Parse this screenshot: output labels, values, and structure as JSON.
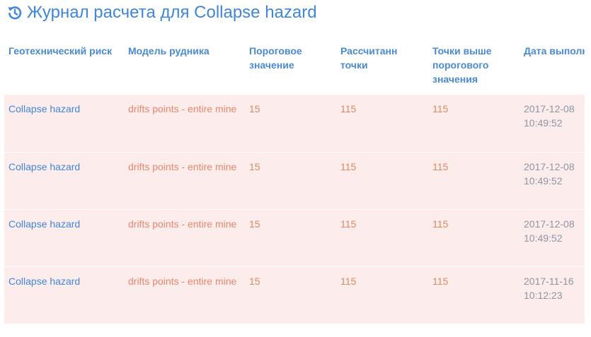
{
  "title": {
    "icon": "history-icon",
    "text": "Журнал расчета для Collapse hazard"
  },
  "table": {
    "columns": [
      "Геотехнический риск",
      "Модель рудника",
      "Пороговое значение",
      "Рассчитанн точки",
      "Точки выше порогового значения",
      "Дата выполнения расчета"
    ],
    "rows": [
      {
        "risk": "Collapse hazard",
        "model": "drifts points - entire mine",
        "threshold": "15",
        "computed": "115",
        "above": "115",
        "date": "2017-12-08 10:49:52"
      },
      {
        "risk": "Collapse hazard",
        "model": "drifts points - entire mine",
        "threshold": "15",
        "computed": "115",
        "above": "115",
        "date": "2017-12-08 10:49:52"
      },
      {
        "risk": "Collapse hazard",
        "model": "drifts points - entire mine",
        "threshold": "15",
        "computed": "115",
        "above": "115",
        "date": "2017-12-08 10:49:52"
      },
      {
        "risk": "Collapse hazard",
        "model": "drifts points - entire mine",
        "threshold": "15",
        "computed": "115",
        "above": "115",
        "date": "2017-11-16 10:12:23"
      }
    ]
  },
  "colors": {
    "title": "#3f87d9",
    "header": "#4a8ad1",
    "row_background": "#fdecec",
    "risk_text": "#3f87d9",
    "model_text": "#e8876a",
    "number_text": "#d98a5f",
    "date_text": "#8c96a3"
  }
}
